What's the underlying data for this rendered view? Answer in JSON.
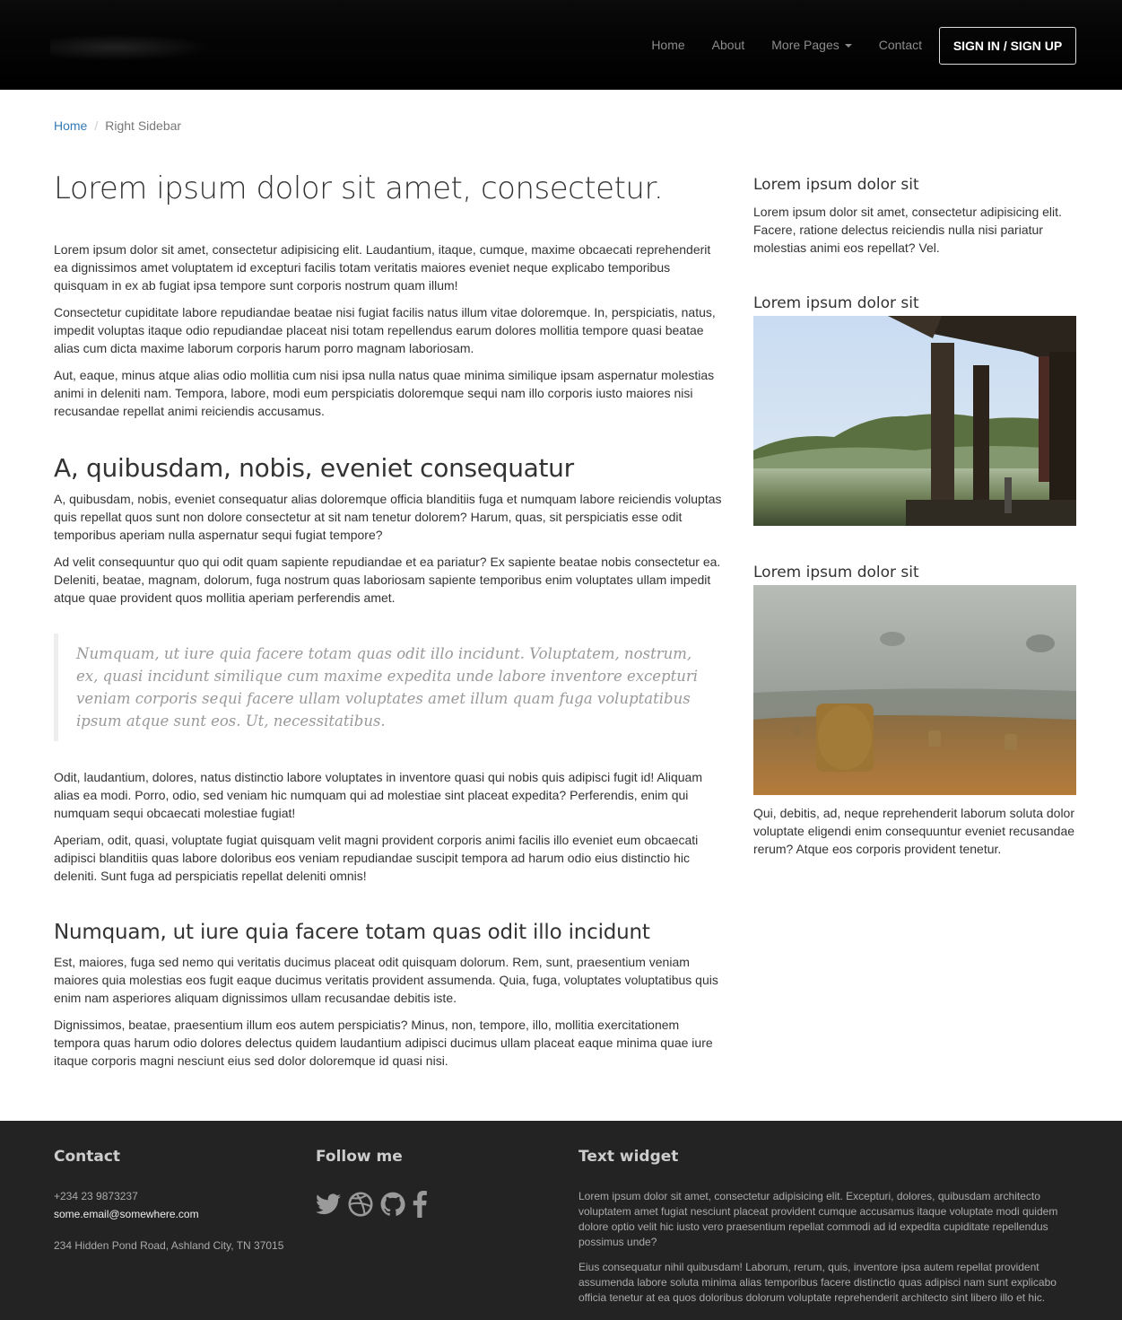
{
  "header": {
    "nav": [
      "Home",
      "About",
      "More Pages",
      "Contact"
    ],
    "signin_label": "SIGN IN / SIGN UP"
  },
  "breadcrumb": {
    "home": "Home",
    "current": "Right Sidebar"
  },
  "main": {
    "title": "Lorem ipsum dolor sit amet, consectetur.",
    "p1": "Lorem ipsum dolor sit amet, consectetur adipisicing elit. Laudantium, itaque, cumque, maxime obcaecati reprehenderit ea dignissimos amet voluptatem id excepturi facilis totam veritatis maiores eveniet neque explicabo temporibus quisquam in ex ab fugiat ipsa tempore sunt corporis nostrum quam illum!",
    "p2": "Consectetur cupiditate labore repudiandae beatae nisi fugiat facilis natus illum vitae doloremque. In, perspiciatis, natus, impedit voluptas itaque odio repudiandae placeat nisi totam repellendus earum dolores mollitia tempore quasi beatae alias cum dicta maxime laborum corporis harum porro magnam laboriosam.",
    "p3": "Aut, eaque, minus atque alias odio mollitia cum nisi ipsa nulla natus quae minima similique ipsam aspernatur molestias animi in deleniti nam. Tempora, labore, modi eum perspiciatis doloremque sequi nam illo corporis iusto maiores nisi recusandae repellat animi reiciendis accusamus.",
    "h2": "A, quibusdam, nobis, eveniet consequatur",
    "p4": "A, quibusdam, nobis, eveniet consequatur alias doloremque officia blanditiis fuga et numquam labore reiciendis voluptas quis repellat quos sunt non dolore consectetur at sit nam tenetur dolorem? Harum, quas, sit perspiciatis esse odit temporibus aperiam nulla aspernatur sequi fugiat tempore?",
    "p5": "Ad velit consequuntur quo qui odit quam sapiente repudiandae et ea pariatur? Ex sapiente beatae nobis consectetur ea. Deleniti, beatae, magnam, dolorum, fuga nostrum quas laboriosam sapiente temporibus enim voluptates ullam impedit atque quae provident quos mollitia aperiam perferendis amet.",
    "quote": "Numquam, ut iure quia facere totam quas odit illo incidunt. Voluptatem, nostrum, ex, quasi incidunt similique cum maxime expedita unde labore inventore excepturi veniam corporis sequi facere ullam voluptates amet illum quam fuga voluptatibus ipsum atque sunt eos. Ut, necessitatibus.",
    "p6": "Odit, laudantium, dolores, natus distinctio labore voluptates in inventore quasi qui nobis quis adipisci fugit id! Aliquam alias ea modi. Porro, odio, sed veniam hic numquam qui ad molestiae sint placeat expedita? Perferendis, enim qui numquam sequi obcaecati molestiae fugiat!",
    "p7": "Aperiam, odit, quasi, voluptate fugiat quisquam velit magni provident corporis animi facilis illo eveniet eum obcaecati adipisci blanditiis quas labore doloribus eos veniam repudiandae suscipit tempora ad harum odio eius distinctio hic deleniti. Sunt fuga ad perspiciatis repellat deleniti omnis!",
    "h3": "Numquam, ut iure quia facere totam quas odit illo incidunt",
    "p8": "Est, maiores, fuga sed nemo qui veritatis ducimus placeat odit quisquam dolorum. Rem, sunt, praesentium veniam maiores quia molestias eos fugit eaque ducimus veritatis provident assumenda. Quia, fuga, voluptates voluptatibus quis enim nam asperiores aliquam dignissimos ullam recusandae debitis iste.",
    "p9": "Dignissimos, beatae, praesentium illum eos autem perspiciatis? Minus, non, tempore, illo, mollitia exercitationem tempora quas harum odio dolores delectus quidem laudantium adipisci ducimus ullam placeat eaque minima quae iure itaque corporis magni nesciunt eius sed dolor doloremque id quasi nisi."
  },
  "sidebar": {
    "w1_title": "Lorem ipsum dolor sit",
    "w1_text": "Lorem ipsum dolor sit amet, consectetur adipisicing elit. Facere, ratione delectus reiciendis nulla nisi pariatur molestias animi eos repellat? Vel.",
    "w2_title": "Lorem ipsum dolor sit",
    "w3_title": "Lorem ipsum dolor sit",
    "w3_text": "Qui, debitis, ad, neque reprehenderit laborum soluta dolor voluptate eligendi enim consequuntur eveniet recusandae rerum? Atque eos corporis provident tenetur."
  },
  "footer": {
    "contact_title": "Contact",
    "phone": "+234 23 9873237",
    "email": "some.email@somewhere.com",
    "address": "234 Hidden Pond Road, Ashland City, TN 37015",
    "follow_title": "Follow me",
    "social_icons": [
      "twitter-icon",
      "dribbble-icon",
      "github-icon",
      "facebook-icon"
    ],
    "text_title": "Text widget",
    "text_p1": "Lorem ipsum dolor sit amet, consectetur adipisicing elit. Excepturi, dolores, quibusdam architecto voluptatem amet fugiat nesciunt placeat provident cumque accusamus itaque voluptate modi quidem dolore optio velit hic iusto vero praesentium repellat commodi ad id expedita cupiditate repellendus possimus unde?",
    "text_p2": "Eius consequatur nihil quibusdam! Laborum, rerum, quis, inventore ipsa autem repellat provident assumenda labore soluta minima alias temporibus facere distinctio quas adipisci nam sunt explicabo officia tenetur at ea quos doloribus dolorum voluptate reprehenderit architecto sint libero illo et hic."
  },
  "colors": {
    "navbar_bg": "#000000",
    "link_blue": "#337ab7",
    "footer_bg": "#232323"
  }
}
